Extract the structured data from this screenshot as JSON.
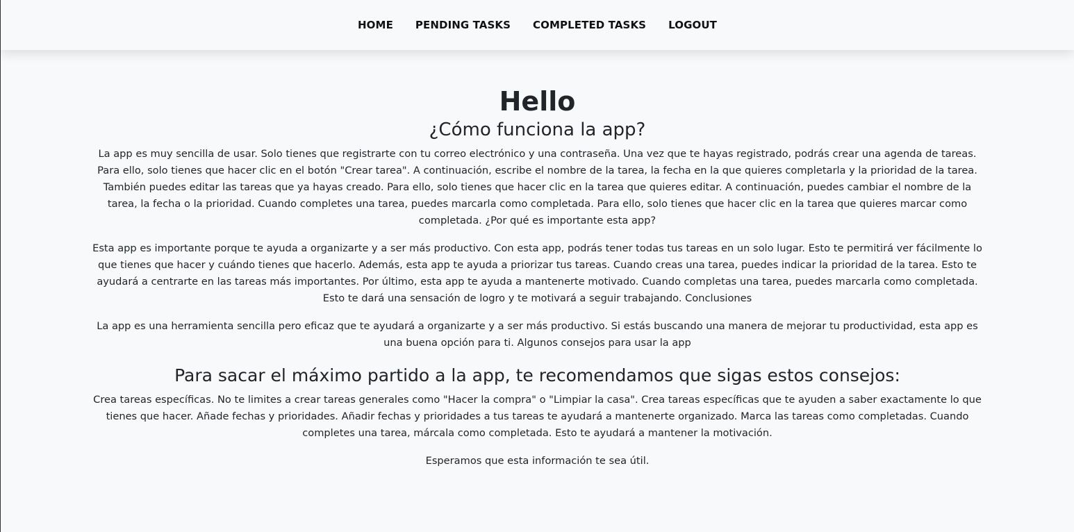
{
  "nav": {
    "items": [
      {
        "label": "HOME"
      },
      {
        "label": "PENDING TASKS"
      },
      {
        "label": "COMPLETED TASKS"
      },
      {
        "label": "LOGOUT"
      }
    ]
  },
  "main": {
    "greeting": "Hello",
    "how_title": "¿Cómo funciona la app?",
    "paragraphs": [
      "La app es muy sencilla de usar. Solo tienes que registrarte con tu correo electrónico y una contraseña. Una vez que te hayas registrado, podrás crear una agenda de tareas. Para ello, solo tienes que hacer clic en el botón \"Crear tarea\". A continuación, escribe el nombre de la tarea, la fecha en la que quieres completarla y la prioridad de la tarea. También puedes editar las tareas que ya hayas creado. Para ello, solo tienes que hacer clic en la tarea que quieres editar. A continuación, puedes cambiar el nombre de la tarea, la fecha o la prioridad. Cuando completes una tarea, puedes marcarla como completada. Para ello, solo tienes que hacer clic en la tarea que quieres marcar como completada. ¿Por qué es importante esta app?",
      "Esta app es importante porque te ayuda a organizarte y a ser más productivo. Con esta app, podrás tener todas tus tareas en un solo lugar. Esto te permitirá ver fácilmente lo que tienes que hacer y cuándo tienes que hacerlo. Además, esta app te ayuda a priorizar tus tareas. Cuando creas una tarea, puedes indicar la prioridad de la tarea. Esto te ayudará a centrarte en las tareas más importantes. Por último, esta app te ayuda a mantenerte motivado. Cuando completas una tarea, puedes marcarla como completada. Esto te dará una sensación de logro y te motivará a seguir trabajando. Conclusiones",
      "La app es una herramienta sencilla pero eficaz que te ayudará a organizarte y a ser más productivo. Si estás buscando una manera de mejorar tu productividad, esta app es una buena opción para ti. Algunos consejos para usar la app"
    ],
    "tips_title": "Para sacar el máximo partido a la app, te recomendamos que sigas estos consejos:",
    "tips_paragraphs": [
      "Crea tareas específicas. No te limites a crear tareas generales como \"Hacer la compra\" o \"Limpiar la casa\". Crea tareas específicas que te ayuden a saber exactamente lo que tienes que hacer. Añade fechas y prioridades. Añadir fechas y prioridades a tus tareas te ayudará a mantenerte organizado. Marca las tareas como completadas. Cuando completes una tarea, márcala como completada. Esto te ayudará a mantener la motivación.",
      "Esperamos que esta información te sea útil."
    ]
  }
}
